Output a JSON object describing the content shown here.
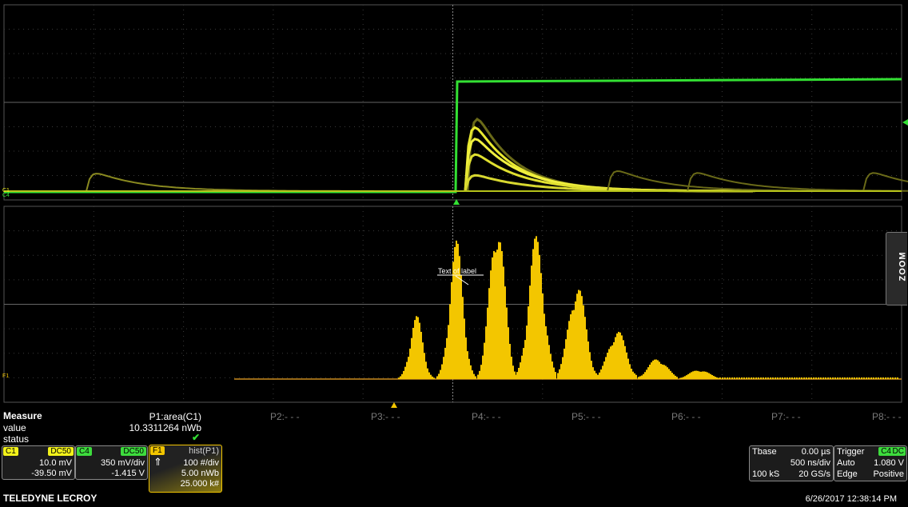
{
  "measure": {
    "title": "Measure",
    "row_value_label": "value",
    "row_status_label": "status",
    "p1_header": "P1:area(C1)",
    "p1_value": "10.3311264 nWb",
    "p1_status": "✔",
    "params": [
      "P2:- - -",
      "P3:- - -",
      "P4:- - -",
      "P5:- - -",
      "P6:- - -",
      "P7:- - -",
      "P8:- - -"
    ]
  },
  "channels": {
    "c1": {
      "name": "C1",
      "coupling": "DC50",
      "vdiv": "10.0 mV",
      "offset": "-39.50 mV",
      "color": "#f2f21a"
    },
    "c4": {
      "name": "C4",
      "coupling": "DC50",
      "vdiv": "350 mV/div",
      "offset": "-1.415 V",
      "color": "#3ddc3d"
    },
    "f1": {
      "name": "F1",
      "func": "hist(P1)",
      "vdiv": "100 #/div",
      "hdiv": "5.00 nWb",
      "count": "25.000 k#",
      "color": "#f3c600",
      "arrow": "⇑"
    }
  },
  "timebase": {
    "label": "Tbase",
    "delay": "0.00 µs",
    "tdiv": "500 ns/div",
    "samples": "100 kS",
    "rate": "20 GS/s"
  },
  "trigger": {
    "label": "Trigger",
    "source": "C4",
    "coupling": "DC",
    "mode": "Auto",
    "level": "1.080 V",
    "type": "Edge",
    "slope": "Positive"
  },
  "annotation": {
    "label": "Text of label"
  },
  "markers": {
    "c1": "C1",
    "c4": "C4",
    "f1": "F1"
  },
  "zoom_label": "ZOOM",
  "brand": "TELEDYNE LECROY",
  "datetime": "6/26/2017 12:38:14 PM",
  "chart_data": {
    "type": "bar",
    "title": "",
    "xlabel": "",
    "ylabel": "",
    "x": [
      1,
      2,
      3,
      4,
      5,
      6,
      7,
      8
    ],
    "values": [
      145,
      315,
      380,
      325,
      225,
      115,
      48,
      22
    ],
    "x_unit": "peak",
    "y_unit": "#"
  }
}
